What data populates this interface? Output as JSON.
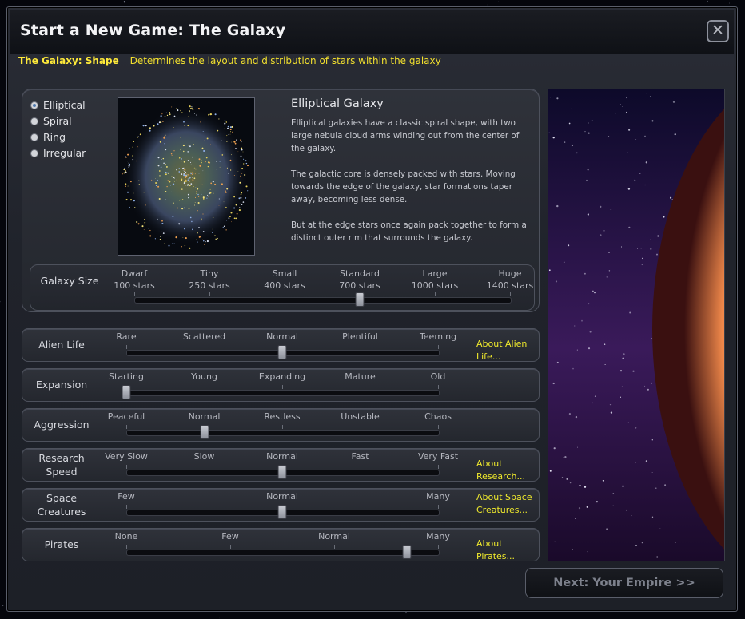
{
  "dialog": {
    "title": "Start a New Game: The Galaxy",
    "close_symbol": "✕"
  },
  "subtitle": {
    "key": "The Galaxy: Shape",
    "description": "Determines the layout and distribution of stars within the galaxy"
  },
  "shape": {
    "options": [
      "Elliptical",
      "Spiral",
      "Ring",
      "Irregular"
    ],
    "selected_index": 0,
    "title": "Elliptical Galaxy",
    "paragraphs": [
      "Elliptical galaxies have a classic spiral shape, with two large nebula cloud arms winding out from the center of the galaxy.",
      "The galactic core is densely packed with stars. Moving towards the edge of the galaxy, star formations taper away, becoming less dense.",
      "But at the edge stars once again pack together to form a distinct outer rim that surrounds the galaxy."
    ]
  },
  "galaxy_size": {
    "label": "Galaxy Size",
    "ticks": [
      {
        "name": "Dwarf",
        "count": "100 stars"
      },
      {
        "name": "Tiny",
        "count": "250 stars"
      },
      {
        "name": "Small",
        "count": "400 stars"
      },
      {
        "name": "Standard",
        "count": "700 stars"
      },
      {
        "name": "Large",
        "count": "1000 stars"
      },
      {
        "name": "Huge",
        "count": "1400 stars"
      }
    ],
    "selected_index": 3
  },
  "settings": [
    {
      "id": "alien-life",
      "label": "Alien Life",
      "ticks": [
        "Rare",
        "Scattered",
        "Normal",
        "Plentiful",
        "Teeming"
      ],
      "selected_index": 2,
      "about": "About Alien Life..."
    },
    {
      "id": "expansion",
      "label": "Expansion",
      "ticks": [
        "Starting",
        "Young",
        "Expanding",
        "Mature",
        "Old"
      ],
      "selected_index": 0,
      "about": ""
    },
    {
      "id": "aggression",
      "label": "Aggression",
      "ticks": [
        "Peaceful",
        "Normal",
        "Restless",
        "Unstable",
        "Chaos"
      ],
      "selected_index": 1,
      "about": ""
    },
    {
      "id": "research-speed",
      "label": "Research Speed",
      "ticks": [
        "Very Slow",
        "Slow",
        "Normal",
        "Fast",
        "Very Fast"
      ],
      "selected_index": 2,
      "about": "About Research..."
    },
    {
      "id": "space-creatures",
      "label": "Space Creatures",
      "ticks": [
        "Few",
        "",
        "Normal",
        "",
        "Many"
      ],
      "selected_index": 2,
      "about": "About Space Creatures..."
    },
    {
      "id": "pirates",
      "label": "Pirates",
      "ticks": [
        "None",
        "Few",
        "Normal",
        "Many"
      ],
      "selected_index": 2.7,
      "about": "About Pirates..."
    }
  ],
  "next_button": "Next: Your Empire >>"
}
